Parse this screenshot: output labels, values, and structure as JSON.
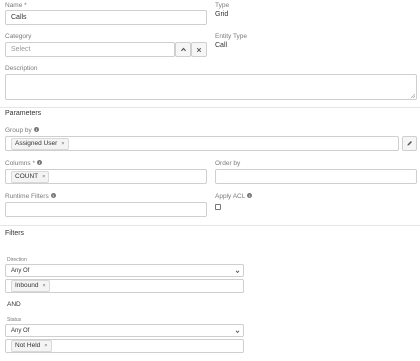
{
  "fields": {
    "name": {
      "label": "Name *",
      "value": "Calls"
    },
    "type": {
      "label": "Type",
      "value": "Grid"
    },
    "category": {
      "label": "Category",
      "placeholder": "Select"
    },
    "entity_type": {
      "label": "Entity Type",
      "value": "Call"
    },
    "description": {
      "label": "Description",
      "value": ""
    }
  },
  "parameters": {
    "heading": "Parameters",
    "group_by": {
      "label": "Group by",
      "tags": [
        "Assigned User"
      ]
    },
    "columns": {
      "label": "Columns *",
      "tags": [
        "COUNT"
      ]
    },
    "order_by": {
      "label": "Order by",
      "value": ""
    },
    "runtime_filters": {
      "label": "Runtime Filters",
      "value": ""
    },
    "apply_acl": {
      "label": "Apply ACL",
      "checked": false
    }
  },
  "filters": {
    "heading": "Filters",
    "direction": {
      "label": "Direction",
      "operator": "Any Of",
      "tags": [
        "Inbound"
      ]
    },
    "joiner": "AND",
    "status": {
      "label": "Status",
      "operator": "Any Of",
      "tags": [
        "Not Held"
      ]
    }
  },
  "icons": {
    "expand": "chevron-up-icon",
    "clear": "close-icon",
    "edit": "pencil-icon",
    "info": "info-circle-icon",
    "select_caret": "chevron-down-icon"
  }
}
